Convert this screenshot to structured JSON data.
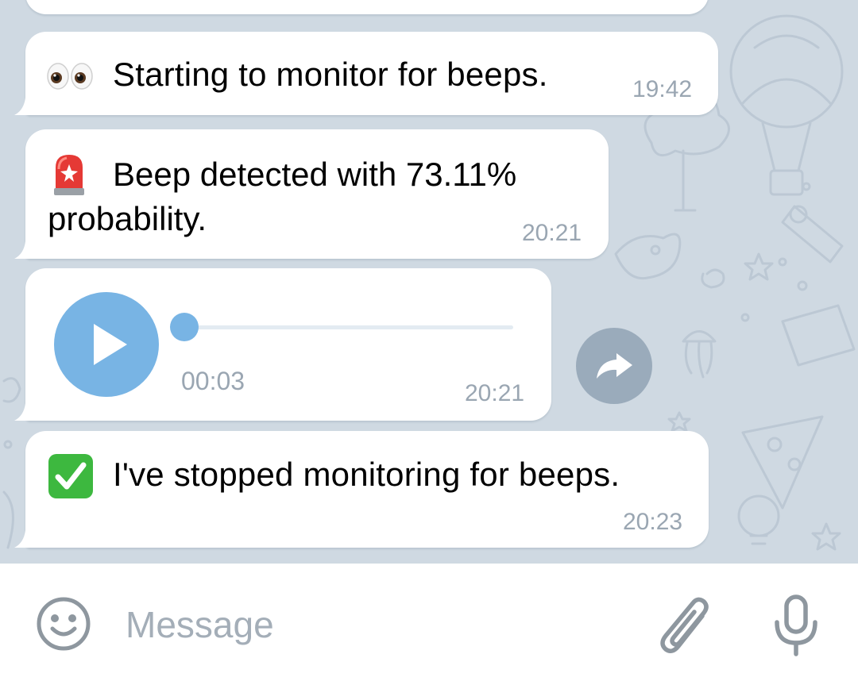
{
  "messages": [
    {
      "emoji": "eyes-emoji",
      "text": "Starting to monitor for beeps.",
      "time": "19:42"
    },
    {
      "emoji": "rotating-light-emoji",
      "line1": "Beep detected with  73.11%",
      "line2": "probability.",
      "time": "20:21"
    },
    {
      "type": "voice",
      "duration": "00:03",
      "time": "20:21",
      "progress": 0
    },
    {
      "emoji": "check-mark-button-emoji",
      "text": "I've stopped monitoring for beeps.",
      "time": "20:23"
    }
  ],
  "input": {
    "placeholder": "Message",
    "value": ""
  },
  "icons": {
    "emoji_button": "smiley-icon",
    "attach": "paperclip-icon",
    "voice": "microphone-icon",
    "forward": "share-arrow-icon",
    "play": "play-icon"
  },
  "colors": {
    "chat_background": "#cfd9e2",
    "bubble": "#ffffff",
    "accent": "#78b4e4",
    "time_text": "#9aa6b2",
    "forward_button": "#9aabbb",
    "input_icons": "#8e979f"
  }
}
